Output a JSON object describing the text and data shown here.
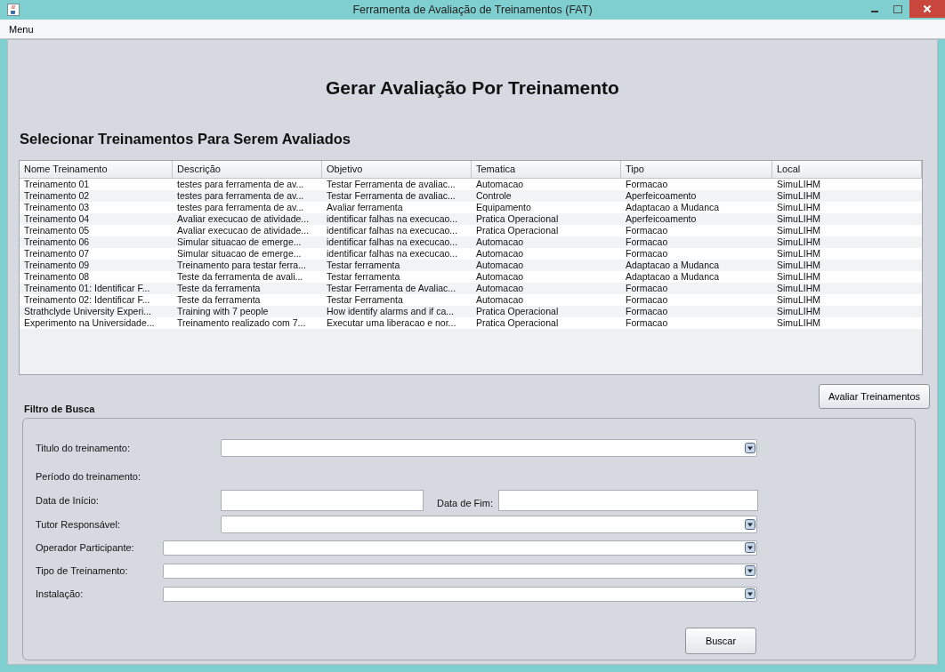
{
  "window": {
    "title": "Ferramenta de Avaliação de Treinamentos (FAT)"
  },
  "menu": [
    "Menu"
  ],
  "heading": "Gerar Avaliação Por Treinamento",
  "subheading": "Selecionar Treinamentos Para Serem Avaliados",
  "table": {
    "columns": [
      "Nome Treinamento",
      "Descrição",
      "Objetivo",
      "Tematica",
      "Tipo",
      "Local"
    ],
    "rows": [
      [
        "Treinamento 01",
        "testes para ferramenta de av...",
        "Testar Ferramenta de avaliac...",
        "Automacao",
        "Formacao",
        "SimuLIHM"
      ],
      [
        "Treinamento 02",
        "testes para ferramenta de av...",
        "Testar Ferramenta de avaliac...",
        "Controle",
        "Aperfeicoamento",
        "SimuLIHM"
      ],
      [
        "Treinamento 03",
        "testes para ferramenta de av...",
        "Avaliar ferramenta",
        "Equipamento",
        "Adaptacao a Mudanca",
        "SimuLIHM"
      ],
      [
        "Treinamento 04",
        "Avaliar execucao de atividade...",
        "identificar falhas na execucao...",
        "Pratica Operacional",
        "Aperfeicoamento",
        "SimuLIHM"
      ],
      [
        "Treinamento 05",
        "Avaliar execucao de atividade...",
        "identificar falhas na execucao...",
        "Pratica Operacional",
        "Formacao",
        "SimuLIHM"
      ],
      [
        "Treinamento 06",
        "Simular situacao de emerge...",
        "identificar falhas na execucao...",
        "Automacao",
        "Formacao",
        "SimuLIHM"
      ],
      [
        "Treinamento 07",
        "Simular situacao de emerge...",
        "identificar falhas na execucao...",
        "Automacao",
        "Formacao",
        "SimuLIHM"
      ],
      [
        "Treinamento 09",
        "Treinamento para testar ferra...",
        "Testar ferramenta",
        "Automacao",
        "Adaptacao a Mudanca",
        "SimuLIHM"
      ],
      [
        "Treinamento 08",
        "Teste da ferramenta de avali...",
        "Testar ferramenta",
        "Automacao",
        "Adaptacao a Mudanca",
        "SimuLIHM"
      ],
      [
        "Treinamento 01: Identificar F...",
        "Teste da ferramenta",
        "Testar Ferramenta de Avaliac...",
        "Automacao",
        "Formacao",
        "SimuLIHM"
      ],
      [
        "Treinamento 02: Identificar F...",
        "Teste da ferramenta",
        "Testar Ferramenta",
        "Automacao",
        "Formacao",
        "SimuLIHM"
      ],
      [
        "Strathclyde University Experi...",
        "Training with 7 people",
        "How identify alarms and if ca...",
        "Pratica Operacional",
        "Formacao",
        "SimuLIHM"
      ],
      [
        "Experimento na Universidade...",
        "Treinamento realizado com 7...",
        "Executar uma liberacao e nor...",
        "Pratica Operacional",
        "Formacao",
        "SimuLIHM"
      ]
    ]
  },
  "evaluate_button": "Avaliar Treinamentos",
  "filter": {
    "title": "Filtro de Busca",
    "fields": [
      {
        "kind": "select",
        "label": "Titulo do treinamento:"
      },
      {
        "kind": "heading",
        "label": "Período do treinamento:"
      },
      {
        "kind": "dates",
        "label": "Data de Início:",
        "second_label": "Data de Fim:"
      },
      {
        "kind": "select",
        "label": "Tutor Responsável:"
      },
      {
        "kind": "select-wide",
        "label": "Operador Participante:"
      },
      {
        "kind": "select-wide",
        "label": "Tipo de Treinamento:"
      },
      {
        "kind": "select-wide",
        "label": "Instalação:"
      }
    ],
    "search_button": "Buscar"
  }
}
